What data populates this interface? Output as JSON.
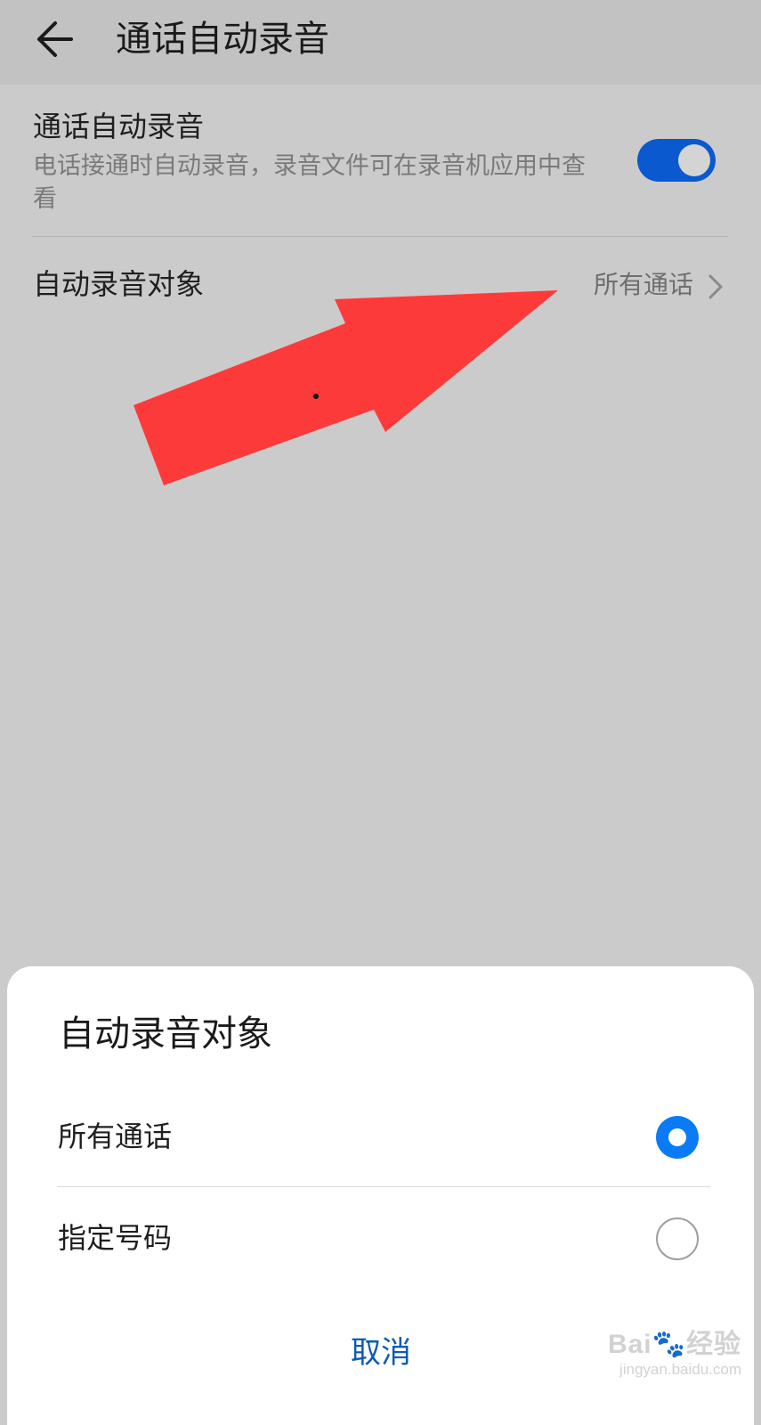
{
  "header": {
    "title": "通话自动录音",
    "back_icon": "arrow-left-icon"
  },
  "auto_record": {
    "title": "通话自动录音",
    "description": "电话接通时自动录音，录音文件可在录音机应用中查看",
    "enabled": true
  },
  "record_target": {
    "label": "自动录音对象",
    "value": "所有通话",
    "chevron_icon": "chevron-right-icon"
  },
  "dialog": {
    "title": "自动录音对象",
    "options": [
      {
        "label": "所有通话",
        "selected": true
      },
      {
        "label": "指定号码",
        "selected": false
      }
    ],
    "cancel_label": "取消"
  },
  "colors": {
    "accent": "#0a7bf5",
    "toggle_on": "#0a59cf",
    "annotation_arrow": "#fd3a3a",
    "cancel_text": "#0a5bb5"
  },
  "watermark": {
    "brand": "Bai🐾经验",
    "url": "jingyan.baidu.com"
  }
}
